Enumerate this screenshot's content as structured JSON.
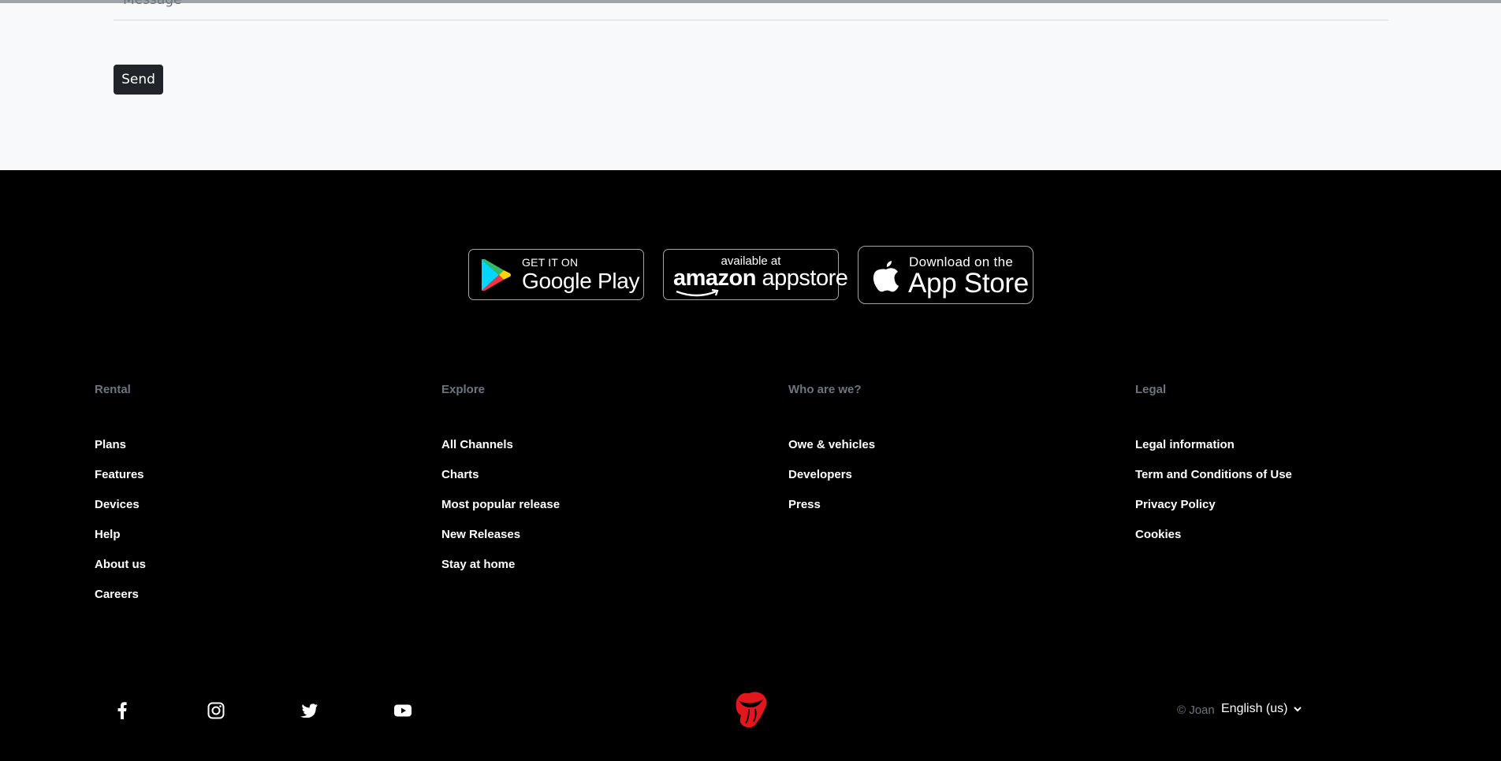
{
  "form": {
    "message_placeholder": "Message",
    "send_label": "Send"
  },
  "badges": {
    "google": {
      "small": "GET IT ON",
      "big": "Google Play"
    },
    "amazon": {
      "small": "available at",
      "big_bold": "amazon",
      "big_rest": "appstore"
    },
    "apple": {
      "small": "Download on the",
      "big": "App Store"
    }
  },
  "footer": {
    "columns": [
      {
        "heading": "Rental",
        "links": [
          "Plans",
          "Features",
          "Devices",
          "Help",
          "About us",
          "Careers"
        ]
      },
      {
        "heading": "Explore",
        "links": [
          "All Channels",
          "Charts",
          "Most popular release",
          "New Releases",
          "Stay at home"
        ]
      },
      {
        "heading": "Who are we?",
        "links": [
          "Owe & vehicles",
          "Developers",
          "Press"
        ]
      },
      {
        "heading": "Legal",
        "links": [
          "Legal information",
          "Term and Conditions of Use",
          "Privacy Policy",
          "Cookies"
        ]
      }
    ],
    "social": [
      "facebook-icon",
      "instagram-icon",
      "twitter-icon",
      "youtube-icon"
    ],
    "copyright": "© Joan",
    "language": "English (us)",
    "colors": {
      "brand_red": "#e4161d",
      "muted": "#6c757d"
    }
  }
}
